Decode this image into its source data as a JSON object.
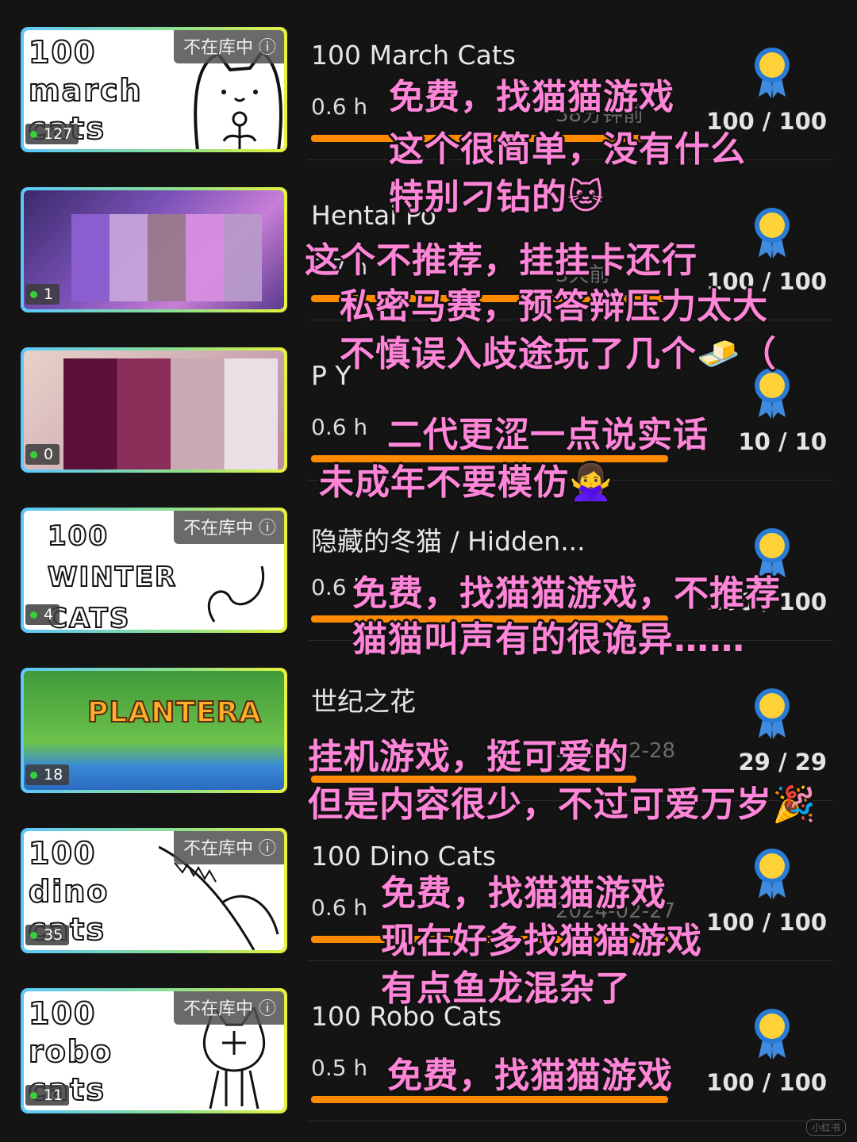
{
  "not_in_library": "不在库中 ⓘ",
  "games": [
    {
      "title": "100 March Cats",
      "hours": "0.6 h",
      "date": "38分钟前",
      "achievements": "100 / 100",
      "owners": "127",
      "cover": "100 march cats",
      "bar_fraction": 0.78
    },
    {
      "title": "Hentai Po",
      "hours": "7.7 h",
      "date": "3天前",
      "achievements": "100 / 100",
      "owners": "1",
      "cover": "",
      "bar_fraction": 0.78
    },
    {
      "title": "P   Y",
      "hours": "0.6 h",
      "date": "",
      "achievements": "10 / 10",
      "owners": "0",
      "cover": "",
      "bar_fraction": 0.78
    },
    {
      "title": "隐藏的冬猫 / Hidden...",
      "hours": "0.6 h",
      "date": "",
      "achievements": "100 / 100",
      "owners": "4",
      "cover": "100 WINTER CATS",
      "bar_fraction": 0.78
    },
    {
      "title": "世纪之花",
      "hours": "",
      "date": "2024-02-28",
      "achievements": "29 / 29",
      "owners": "18",
      "cover": "PLANTERA",
      "bar_fraction": 0.78
    },
    {
      "title": "100 Dino Cats",
      "hours": "0.6 h",
      "date": "2024-02-27",
      "achievements": "100 / 100",
      "owners": "35",
      "cover": "100 dino cats",
      "bar_fraction": 0.78
    },
    {
      "title": "100 Robo Cats",
      "hours": "0.5 h",
      "date": "",
      "achievements": "100 / 100",
      "owners": "11",
      "cover": "100 robo cats",
      "bar_fraction": 0.78
    }
  ],
  "annotations": [
    "免费，找猫猫游戏",
    "这个很简单，没有什么",
    "特别刁钻的🐱",
    "这个不推荐，挂挂卡还行",
    "私密马赛，预答辩压力太大",
    "不慎误入歧途玩了几个🧈（",
    "二代更涩一点说实话",
    "未成年不要模仿🙅‍♀️",
    "免费，找猫猫游戏，不推荐",
    "猫猫叫声有的很诡异……",
    "挂机游戏，挺可爱的",
    "但是内容很少，不过可爱万岁🎉",
    "免费，找猫猫游戏",
    "现在好多找猫猫游戏",
    "有点鱼龙混杂了",
    "免费，找猫猫游戏"
  ],
  "watermark": "小红书",
  "colors": {
    "annotation": "#ff85d9",
    "bar": "#ff8a00",
    "border_start": "#5cc7ff",
    "border_end": "#e7f23d"
  }
}
